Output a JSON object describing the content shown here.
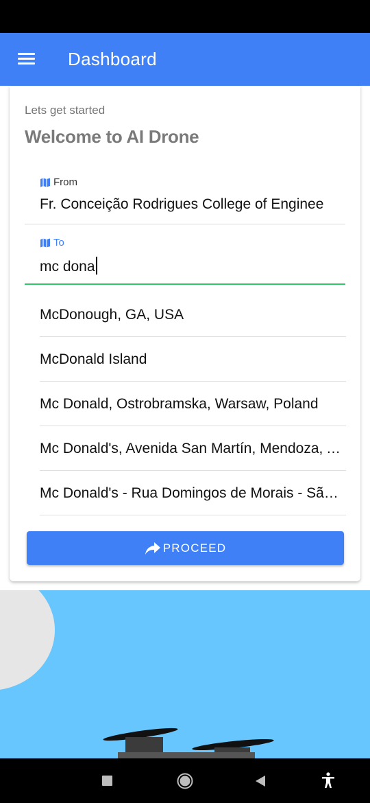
{
  "app_bar": {
    "title": "Dashboard",
    "menu_icon": "hamburger-menu-icon",
    "color": "#3f80f7"
  },
  "card": {
    "subtitle": "Lets get started",
    "headline": "Welcome to AI Drone"
  },
  "from_field": {
    "label": "From",
    "icon": "map-icon",
    "value": "Fr. Conceição Rodrigues College of Enginee"
  },
  "to_field": {
    "label": "To",
    "icon": "map-icon",
    "value": "mc dona",
    "focus_color": "#34c46a"
  },
  "suggestions": [
    "McDonough, GA, USA",
    "McDonald Island",
    "Mc Donald, Ostrobramska, Warsaw, Poland",
    "Mc Donald's, Avenida San Martín, Mendoza, Argentina",
    "Mc Donald's - Rua Domingos de Morais - São Paulo"
  ],
  "proceed_button": {
    "label": "PROCEED",
    "icon": "share-arrow-icon"
  },
  "nav_bar": {
    "recents": "square-icon",
    "home": "circle-home-icon",
    "back": "triangle-back-icon",
    "accessibility": "accessibility-icon"
  }
}
